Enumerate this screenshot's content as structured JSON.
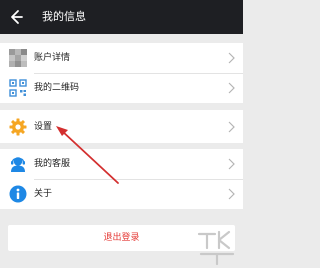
{
  "header": {
    "title": "我的信息"
  },
  "groups": {
    "account": [
      {
        "label": "账户详情",
        "icon": "avatar-icon"
      },
      {
        "label": "我的二维码",
        "icon": "qr-code-icon"
      }
    ],
    "settings": [
      {
        "label": "设置",
        "icon": "gear-icon"
      }
    ],
    "help": [
      {
        "label": "我的客服",
        "icon": "customer-service-icon"
      },
      {
        "label": "关于",
        "icon": "info-icon"
      }
    ]
  },
  "logout": {
    "label": "退出登录"
  },
  "colors": {
    "header_bg": "#1e1f23",
    "background": "#ebebeb",
    "logout_text": "#e53935",
    "gear": "#f5a623",
    "service": "#1e88e5",
    "info": "#1e88e5",
    "annotation_arrow": "#d32f2f"
  }
}
